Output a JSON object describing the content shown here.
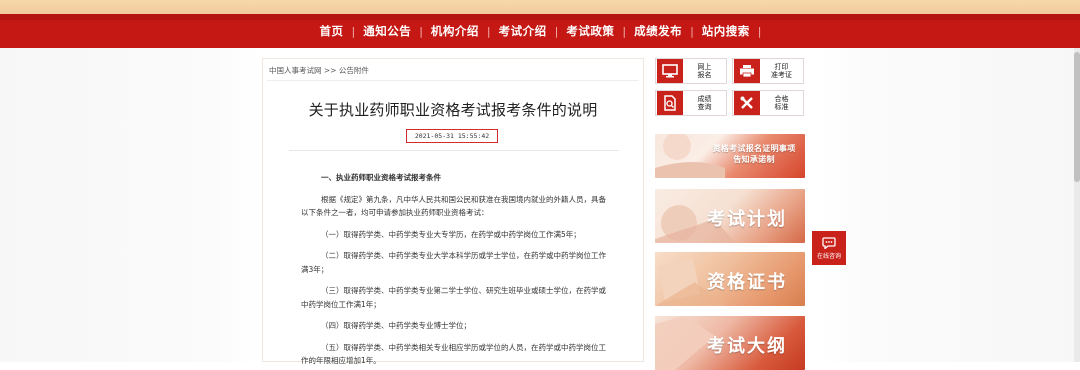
{
  "nav": {
    "items": [
      "首页",
      "通知公告",
      "机构介绍",
      "考试介绍",
      "考试政策",
      "成绩发布",
      "站内搜索"
    ]
  },
  "breadcrumb": {
    "home": "中国人事考试网",
    "sep": ">>",
    "current": "公告附件"
  },
  "article": {
    "title": "关于执业药师职业资格考试报考条件的说明",
    "date": "2021-05-31 15:55:42",
    "section_title": "一、执业药师职业资格考试报考条件",
    "paragraphs": [
      "根据《规定》第九条，凡中华人民共和国公民和获准在我国境内就业的外籍人员，具备以下条件之一者，均可申请参加执业药师职业资格考试：",
      "（一）取得药学类、中药学类专业大专学历，在药学或中药学岗位工作满5年；",
      "（二）取得药学类、中药学类专业大学本科学历或学士学位，在药学或中药学岗位工作满3年；",
      "（三）取得药学类、中药学类专业第二学士学位、研究生班毕业或硕士学位，在药学或中药学岗位工作满1年；",
      "（四）取得药学类、中药学类专业博士学位；",
      "（五）取得药学类、中药学类相关专业相应学历或学位的人员，在药学或中药学岗位工作的年限相应增加1年。"
    ]
  },
  "quick_links": [
    {
      "label_line1": "网上",
      "label_line2": "报名",
      "icon": "monitor-icon"
    },
    {
      "label_line1": "打印",
      "label_line2": "准考证",
      "icon": "printer-icon"
    },
    {
      "label_line1": "成绩",
      "label_line2": "查询",
      "icon": "search-document-icon"
    },
    {
      "label_line1": "合格",
      "label_line2": "标准",
      "icon": "tools-icon"
    }
  ],
  "banners": [
    {
      "line1": "资格考试报名证明事项",
      "line2": "告知承诺制"
    },
    {
      "text": "考试计划"
    },
    {
      "text": "资格证书"
    },
    {
      "text": "考试大纲"
    }
  ],
  "online": {
    "label": "在线咨询",
    "icon": "chat-bubble-icon"
  },
  "colors": {
    "brand_red": "#c51814",
    "accent_red": "#c8221b"
  }
}
